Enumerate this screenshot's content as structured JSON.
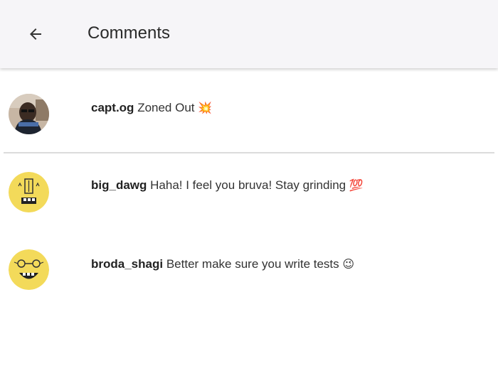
{
  "header": {
    "title": "Comments",
    "back_icon": "arrow-left-icon"
  },
  "caption": {
    "username": "capt.og",
    "text": "Zoned Out",
    "emoji": "💥"
  },
  "comments": [
    {
      "username": "big_dawg",
      "text": "Haha! I feel you bruva! Stay grinding",
      "emoji": "💯"
    },
    {
      "username": "broda_shagi",
      "text": "Better make sure you write tests",
      "emoji": "😉"
    }
  ],
  "colors": {
    "app_bar": "#f6f5f8",
    "avatar_yellow": "#f3da5a",
    "divider": "#dcdcdc"
  }
}
